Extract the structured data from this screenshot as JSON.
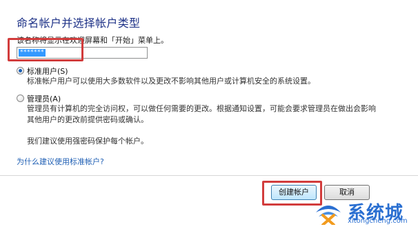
{
  "header": {
    "title": "命名帐户并选择帐户类型",
    "description": "该名称将显示在欢迎屏幕和「开始」菜单上。"
  },
  "name_field": {
    "value": "*******"
  },
  "account_types": [
    {
      "label": "标准用户(S)",
      "selected": true,
      "description_lines": [
        "标准帐户用户可以使用大多数软件以及更改不影响其他用户或计算机安全的系统设置。"
      ]
    },
    {
      "label": "管理员(A)",
      "selected": false,
      "description_lines": [
        "管理员有计算机的完全访问权，可以做任何需要的更改。根据通知设置，可能会要求管理员在做出会影响",
        "其他用户的更改前提供密码或确认。"
      ]
    }
  ],
  "recommendation": "我们建议使用强密码保护每个帐户。",
  "help_link": "为什么建议使用标准帐户?",
  "buttons": {
    "create": "创建帐户",
    "cancel": "取消"
  },
  "watermark": {
    "brand": "系统城",
    "url": "xitongcheng.com"
  },
  "colors": {
    "title": "#1e3287",
    "link": "#1f5fb4",
    "highlight": "#d23c3c",
    "selection": "#3399ff",
    "watermark": "#2a6fd1"
  }
}
